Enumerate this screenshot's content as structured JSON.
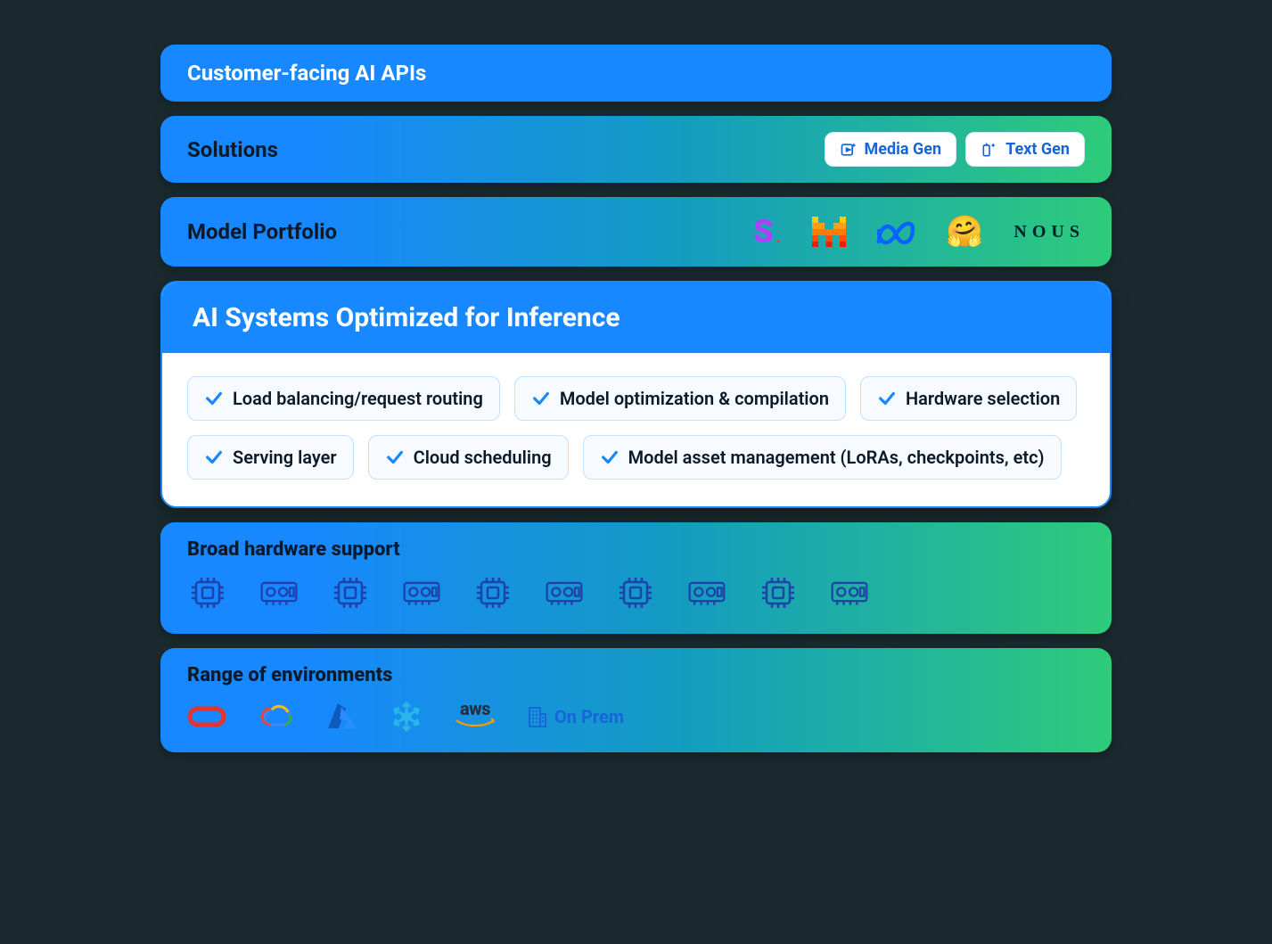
{
  "rows": {
    "apis": {
      "title": "Customer-facing AI APIs"
    },
    "solutions": {
      "title": "Solutions",
      "pills": [
        {
          "icon": "media-gen-icon",
          "label": "Media Gen"
        },
        {
          "icon": "text-gen-icon",
          "label": "Text Gen"
        }
      ]
    },
    "portfolio": {
      "title": "Model Portfolio",
      "logos": [
        {
          "name": "stability-logo"
        },
        {
          "name": "mistral-logo"
        },
        {
          "name": "meta-logo"
        },
        {
          "name": "huggingface-logo"
        },
        {
          "name": "nous-logo",
          "text": "NOUS"
        }
      ]
    }
  },
  "card": {
    "title": "AI Systems Optimized for Inference",
    "features": [
      "Load balancing/request routing",
      "Model optimization & compilation",
      "Hardware selection",
      "Serving layer",
      "Cloud scheduling",
      "Model asset management (LoRAs, checkpoints, etc)"
    ]
  },
  "hardware": {
    "title": "Broad hardware support",
    "count": 10
  },
  "environments": {
    "title": "Range of environments",
    "items": [
      {
        "name": "oracle-logo"
      },
      {
        "name": "gcp-logo"
      },
      {
        "name": "azure-logo"
      },
      {
        "name": "snowflake-logo"
      },
      {
        "name": "aws-logo"
      },
      {
        "name": "onprem-label",
        "text": "On Prem"
      }
    ]
  }
}
